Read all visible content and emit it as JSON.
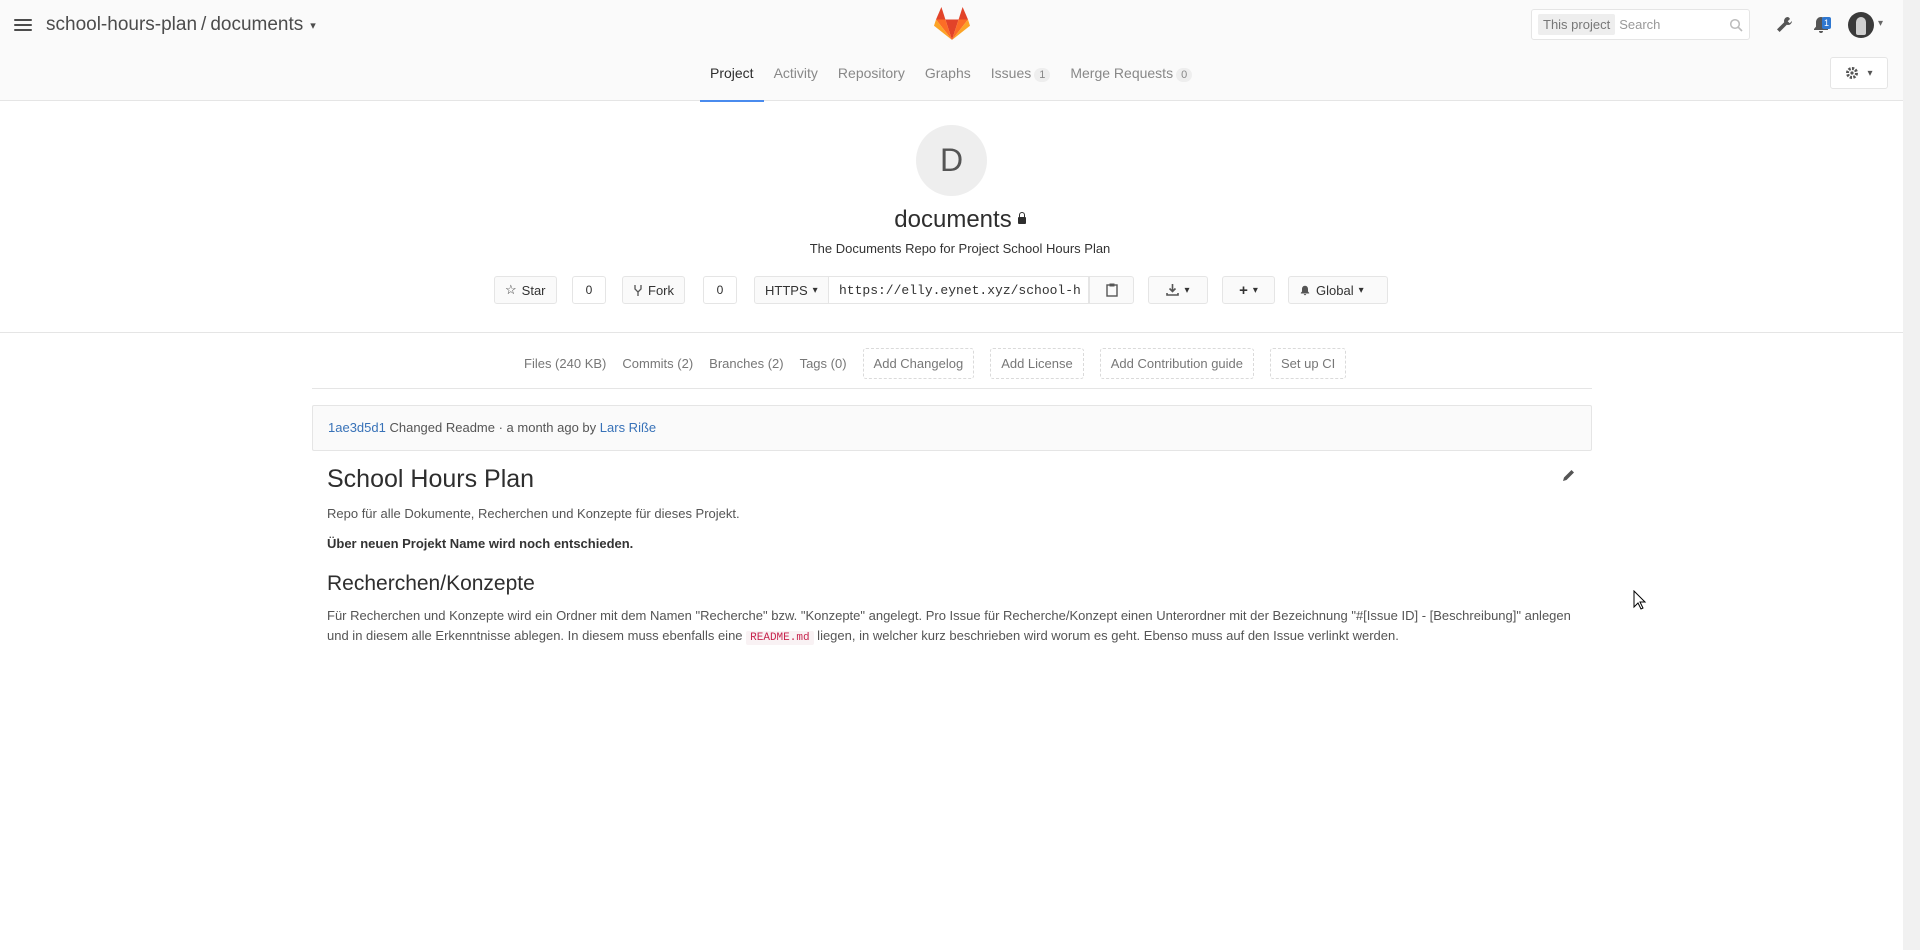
{
  "header": {
    "breadcrumb_group": "school-hours-plan",
    "breadcrumb_sep": "/",
    "breadcrumb_project": "documents",
    "search_scope": "This project",
    "search_placeholder": "Search",
    "notifications_count": "1"
  },
  "nav": {
    "tabs": [
      {
        "label": "Project",
        "active": true
      },
      {
        "label": "Activity"
      },
      {
        "label": "Repository"
      },
      {
        "label": "Graphs"
      },
      {
        "label": "Issues",
        "count": "1"
      },
      {
        "label": "Merge Requests",
        "count": "0"
      }
    ]
  },
  "project": {
    "avatar_letter": "D",
    "name": "documents",
    "description": "The Documents Repo for Project School Hours Plan",
    "star_label": "Star",
    "star_count": "0",
    "fork_label": "Fork",
    "fork_count": "0",
    "protocol": "HTTPS",
    "clone_url": "https://elly.eynet.xyz/school-h",
    "notification_level": "Global"
  },
  "stats": {
    "files": "Files (240 KB)",
    "commits": "Commits (2)",
    "branches": "Branches (2)",
    "tags": "Tags (0)",
    "add_changelog": "Add Changelog",
    "add_license": "Add License",
    "add_contribution": "Add Contribution guide",
    "setup_ci": "Set up CI"
  },
  "commit": {
    "sha": "1ae3d5d1",
    "message": "Changed Readme · a month ago by",
    "author": "Lars Riße"
  },
  "readme": {
    "h1": "School Hours Plan",
    "p1": "Repo für alle Dokumente, Recherchen und Konzepte für dieses Projekt.",
    "p2": "Über neuen Projekt Name wird noch entschieden.",
    "h2": "Recherchen/Konzepte",
    "p3_before": "Für Recherchen und Konzepte wird ein Ordner mit dem Namen \"Recherche\" bzw. \"Konzepte\" angelegt. Pro Issue für Recherche/Konzept einen Unterordner mit der Bezeichnung \"#[Issue ID] - [Beschreibung]\" anlegen und in diesem alle Erkenntnisse ablegen. In diesem muss ebenfalls eine ",
    "p3_code": "README.md",
    "p3_after": " liegen, in welcher kurz beschrieben wird worum es geht. Ebenso muss auf den Issue verlinkt werden."
  }
}
